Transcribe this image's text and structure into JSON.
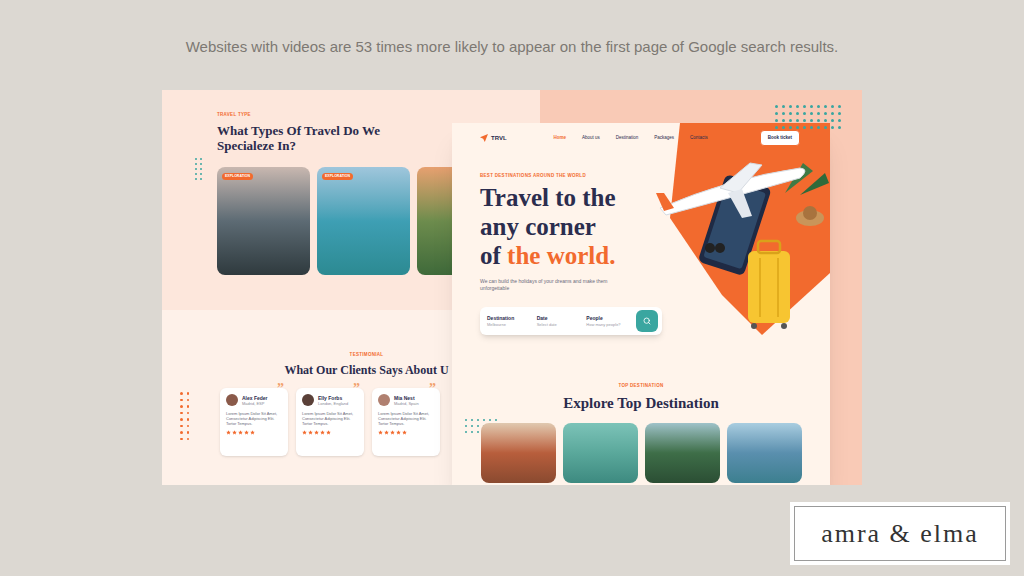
{
  "caption": "Websites with videos are 53 times more likely to appear on the first page of Google search results.",
  "back_page": {
    "travel_types": {
      "eyebrow": "TRAVEL TYPE",
      "title": "What Types Of Travel Do We Specialeze In?",
      "cards": [
        {
          "badge": "EXPLORATION"
        },
        {
          "badge": "EXPLORATION"
        },
        {}
      ]
    },
    "testimonials": {
      "eyebrow": "TESTIMONIAL",
      "title": "What Our Clients Says About U",
      "quote_mark": "”",
      "cards": [
        {
          "name": "Alex Feder",
          "location": "Madrid, ESP",
          "text": "Lorem Ipsum Dolor Sit Amet, Consectetur Adipiscing Elit. Tortor Tempus.",
          "stars": 5
        },
        {
          "name": "Elly Forbs",
          "location": "London, England",
          "text": "Lorem Ipsum Dolor Sit Amet, Consectetur Adipiscing Elit. Tortor Tempus.",
          "stars": 5
        },
        {
          "name": "Mia Nest",
          "location": "Madrid, Spain",
          "text": "Lorem Ipsum Dolor Sit Amet, Consectetur Adipiscing Elit. Tortor Tempus.",
          "stars": 5
        }
      ]
    }
  },
  "front_page": {
    "logo": "TRVL",
    "nav": [
      {
        "label": "Home",
        "selected": true
      },
      {
        "label": "About us",
        "selected": false
      },
      {
        "label": "Destination",
        "selected": false
      },
      {
        "label": "Packages",
        "selected": false
      },
      {
        "label": "Contacts",
        "selected": false
      }
    ],
    "cta": "Book ticket",
    "hero": {
      "eyebrow": "BEST DESTINATIONS AROUND THE WORLD",
      "title_lines": [
        {
          "parts": [
            {
              "text": "Travel to the",
              "highlight": false
            }
          ]
        },
        {
          "parts": [
            {
              "text": "any corner",
              "highlight": false
            }
          ]
        },
        {
          "parts": [
            {
              "text": "of ",
              "highlight": false
            },
            {
              "text": "the world.",
              "highlight": true
            }
          ]
        }
      ],
      "subtitle": "We can build the holidays of your dreams and make them unforgettable"
    },
    "search": {
      "fields": [
        {
          "label": "Destination",
          "value": "Melbourne"
        },
        {
          "label": "Date",
          "value": "Select date"
        },
        {
          "label": "People",
          "value": "How many people?"
        }
      ]
    },
    "top_destinations": {
      "eyebrow": "TOP DESTINATION",
      "title": "Explore Top Destination"
    }
  },
  "brand": "amra & elma"
}
